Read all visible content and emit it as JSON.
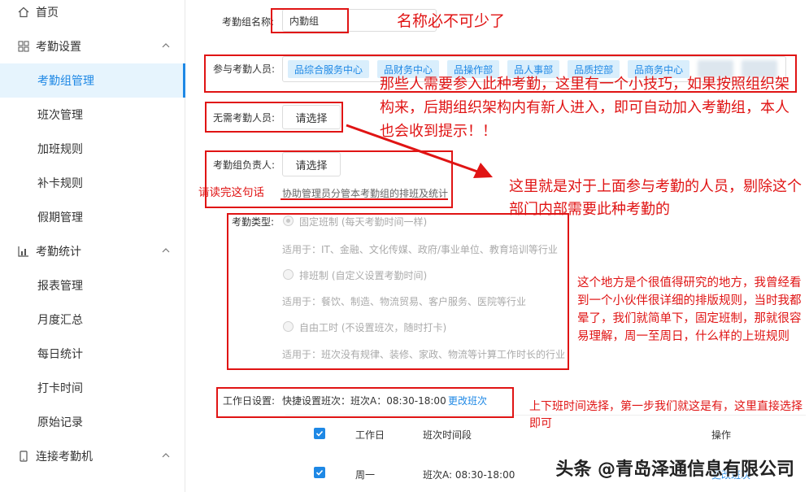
{
  "sidebar": {
    "home": "首页",
    "attendance_settings": "考勤设置",
    "settings_items": [
      "考勤组管理",
      "班次管理",
      "加班规则",
      "补卡规则",
      "假期管理"
    ],
    "attendance_stats": "考勤统计",
    "stats_items": [
      "报表管理",
      "月度汇总",
      "每日统计",
      "打卡时间",
      "原始记录"
    ],
    "connect_device": "连接考勤机"
  },
  "form": {
    "group_name_label": "考勤组名称:",
    "group_name_value": "内勤组",
    "members_label": "参与考勤人员:",
    "member_tags": [
      "综合服务中心",
      "财务中心",
      "操作部",
      "人事部",
      "质控部",
      "商务中心"
    ],
    "excluded_label": "无需考勤人员:",
    "excluded_button": "请选择",
    "owner_label": "考勤组负责人:",
    "owner_button": "请选择",
    "owner_hint": "协助管理员分管本考勤组的排班及统计",
    "type_label": "考勤类型:",
    "type_options": [
      {
        "title": "固定班制 (每天考勤时间一样)",
        "desc": "适用于：IT、金融、文化传媒、政府/事业单位、教育培训等行业"
      },
      {
        "title": "排班制 (自定义设置考勤时间)",
        "desc": "适用于：餐饮、制造、物流贸易、客户服务、医院等行业"
      },
      {
        "title": "自由工时 (不设置班次，随时打卡)",
        "desc": "适用于：班次没有规律、装修、家政、物流等计算工作时长的行业"
      }
    ],
    "workday_label": "工作日设置:",
    "workday_quick": "快捷设置班次：班次A：08:30-18:00",
    "workday_change": "更改班次"
  },
  "table": {
    "headers": [
      "工作日",
      "班次时间段",
      "操作"
    ],
    "rows": [
      {
        "day": "周一",
        "shift": "班次A: 08:30-18:00",
        "action": "更改班次"
      }
    ]
  },
  "annotations": {
    "a1": "名称必不可少了",
    "a2": "那些人需要参入此种考勤，这里有一个小技巧，如果按照组织架构来，后期组织架构内有新人进入，即可自动加入考勤组，本人也会收到提示！！",
    "a3": "这里就是对于上面参与考勤的人员，剔除这个部门内部需要此种考勤的",
    "a4": "请读完这句话",
    "a5": "这个地方是个很值得研究的地方，我曾经看到一个小伙伴很详细的排版规则，当时我都晕了，我们就简单下，固定班制，那就很容易理解，周一至周日，什么样的上班规则",
    "a6": "上下班时间选择，第一步我们就这是有，这里直接选择即可"
  },
  "watermark": "头条 @青岛泽通信息有限公司",
  "colors": {
    "accent": "#1e88e5",
    "annotation": "#e01414",
    "active_bg": "#e6f4fd"
  }
}
